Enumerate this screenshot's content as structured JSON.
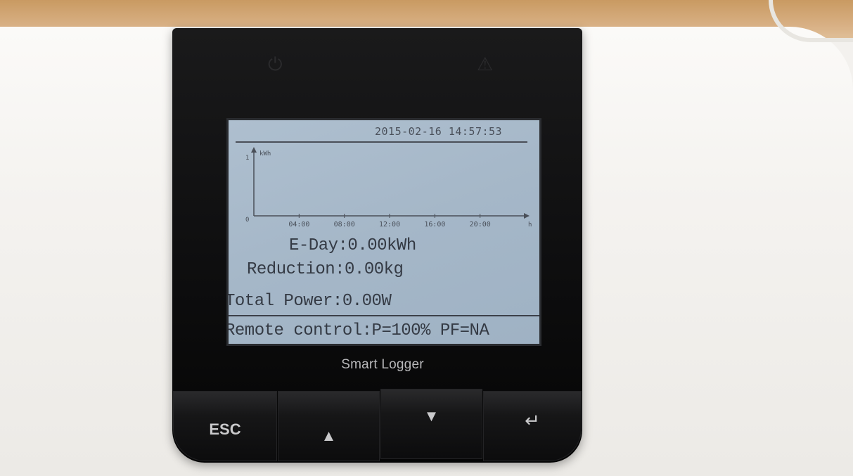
{
  "device": {
    "brand_label": "Smart Logger",
    "indicators": [
      {
        "icon": "power-icon"
      },
      {
        "icon": "warning-icon"
      }
    ]
  },
  "lcd": {
    "datetime": "2015-02-16 14:57:53",
    "chart": {
      "y_label": "kWh",
      "y_top_tick": "1",
      "y_zero_tick": "0",
      "x_ticks": [
        "04:00",
        "08:00",
        "12:00",
        "16:00",
        "20:00"
      ],
      "x_unit": "h"
    },
    "eday": "E-Day:0.00kWh",
    "reduction": "Reduction:0.00kg",
    "total_power": "Total Power:0.00W",
    "remote_control": "Remote control:P=100% PF=NA"
  },
  "buttons": {
    "esc_label": "ESC",
    "up_icon": "arrow-up-icon",
    "down_icon": "arrow-down-icon",
    "enter_icon": "enter-icon"
  },
  "colors": {
    "lcd_background": "#a5b7c8",
    "panel": "#111112",
    "housing": "#f4f2ef"
  }
}
